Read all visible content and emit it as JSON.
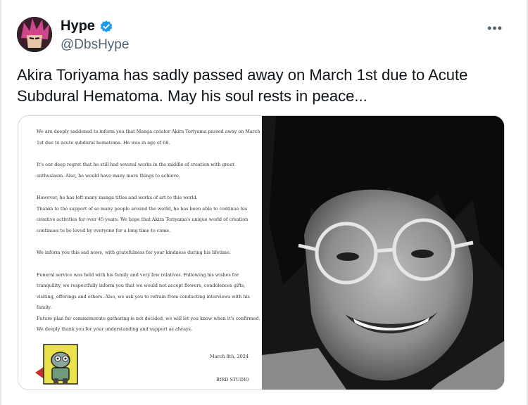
{
  "author": {
    "display_name": "Hype",
    "handle": "@DbsHype",
    "verified_color": "#1d9bf0"
  },
  "tweet": {
    "text": "Akira Toriyama has sadly passed away on March 1st due to Acute Subdural Hematoma. May his soul rests in peace..."
  },
  "statement": {
    "lines": [
      "We are deeply saddened to inform you that Manga creator Akira Toriyama passed away on March",
      "1st due to acute subdural hematoma. He was in age of 68.",
      "",
      "It's our deep regret that he still had several works in the middle of creation with great",
      "enthusiasm. Also, he would have many more things to achieve.",
      "",
      "However, he has left many manga titles and works of art to this world.",
      "Thanks to the support of so many people around the world, he has been able to continue his",
      "creative activities for over 45 years. We hope that Akira Toriyama's unique world of creation",
      "continues to be loved by everyone for a long time to come.",
      "",
      "We inform you this sad news, with gratefulness for your kindness during his lifetime.",
      "",
      "Funeral service was held with his family and very few relatives. Following his wishes for",
      "tranquility, we respectfully inform you that we would not accept flowers, condolences gifts,",
      "visiting, offerings and others. Also, we ask you to refrain from conducting interviews with his",
      "family.",
      "Future plan for commemorate gathering is not decided, we will let you know when it's confirmed.",
      "We deeply thank you for your understanding and support as always."
    ],
    "date": "March 8th, 2024",
    "signature": "BIRD STUDIO"
  },
  "icons": {
    "more": "more-options-icon",
    "verified": "verified-badge-icon",
    "mascot": "robot-mascot-icon"
  }
}
